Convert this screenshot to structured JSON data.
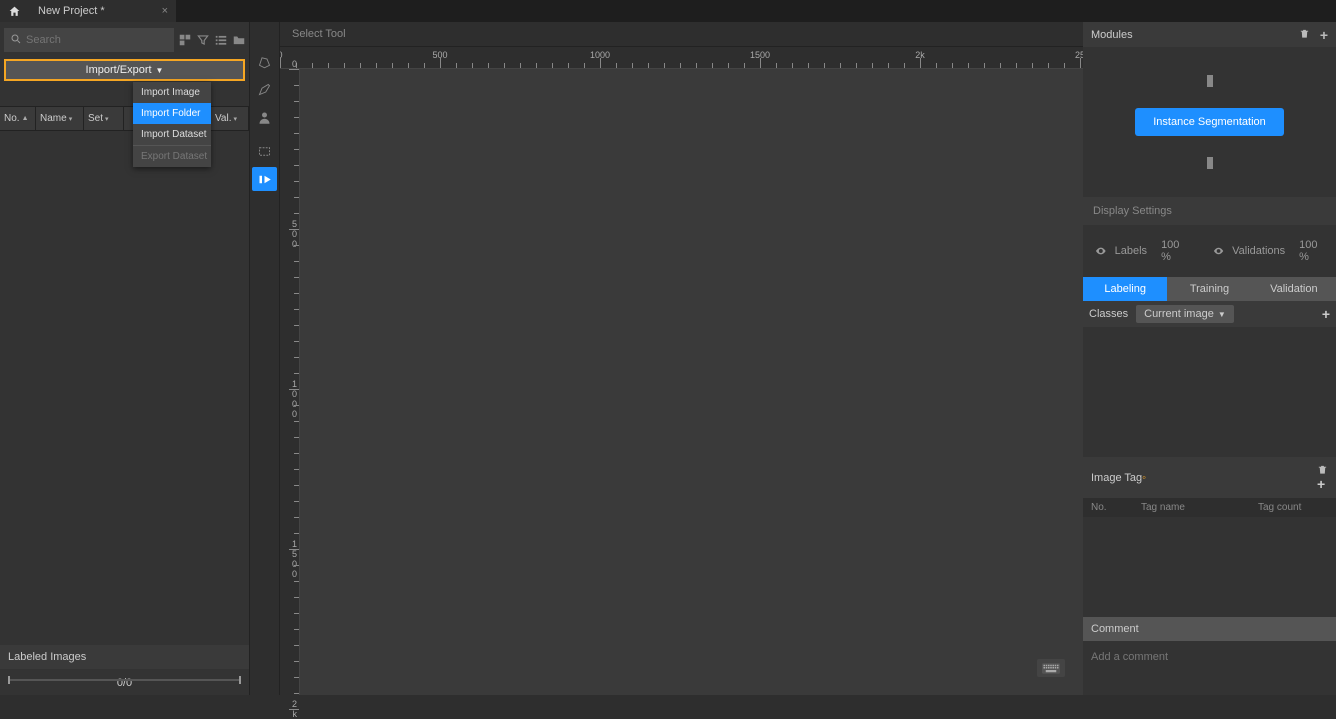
{
  "tab": {
    "title": "New Project *"
  },
  "search": {
    "placeholder": "Search"
  },
  "import_export": {
    "label": "Import/Export",
    "menu": {
      "import_image": "Import Image",
      "import_folder": "Import Folder",
      "import_dataset": "Import Dataset",
      "export_dataset": "Export Dataset"
    }
  },
  "columns": {
    "no": "No.",
    "name": "Name",
    "set": "Set",
    "val": "Val."
  },
  "labeled_images": {
    "title": "Labeled Images",
    "progress": "0/0"
  },
  "select_tool": "Select Tool",
  "ruler_h": [
    "0",
    "500",
    "1000",
    "1500",
    "2k",
    "25"
  ],
  "ruler_v_groups": [
    [
      "0"
    ],
    [
      "5",
      "0",
      "0"
    ],
    [
      "1",
      "0",
      "0",
      "0"
    ],
    [
      "1",
      "5",
      "0",
      "0"
    ],
    [
      "2",
      "k"
    ]
  ],
  "modules": {
    "title": "Modules",
    "chip": "Instance Segmentation"
  },
  "display_settings": {
    "title": "Display Settings",
    "labels": "Labels",
    "labels_pct": "100 %",
    "validations": "Validations",
    "validations_pct": "100 %"
  },
  "tabs": {
    "labeling": "Labeling",
    "training": "Training",
    "validation": "Validation"
  },
  "classes": {
    "label": "Classes",
    "scope": "Current image"
  },
  "image_tag": {
    "title": "Image Tag",
    "cols": {
      "no": "No.",
      "name": "Tag name",
      "count": "Tag count"
    }
  },
  "comment": {
    "title": "Comment",
    "placeholder": "Add a comment"
  }
}
